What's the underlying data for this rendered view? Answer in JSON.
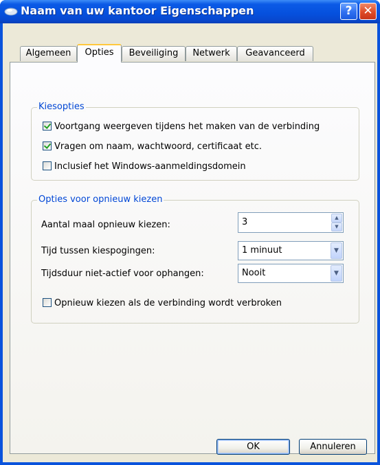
{
  "window": {
    "title": "Naam van uw kantoor Eigenschappen",
    "help_label": "?",
    "close_label": "✕"
  },
  "tabs": [
    {
      "label": "Algemeen"
    },
    {
      "label": "Opties"
    },
    {
      "label": "Beveiliging"
    },
    {
      "label": "Netwerk"
    },
    {
      "label": "Geavanceerd"
    }
  ],
  "active_tab": "Opties",
  "dial_options": {
    "legend": "Kiesopties",
    "checkboxes": [
      {
        "label": "Voortgang weergeven tijdens het maken van de verbinding",
        "checked": true
      },
      {
        "label": "Vragen om naam, wachtwoord, certificaat etc.",
        "checked": true
      },
      {
        "label": "Inclusief het Windows-aanmeldingsdomein",
        "checked": false
      }
    ]
  },
  "redial_options": {
    "legend": "Opties voor opnieuw kiezen",
    "redial_attempts_label": "Aantal maal opnieuw kiezen:",
    "redial_attempts_value": "3",
    "time_between_label": "Tijd tussen kiespogingen:",
    "time_between_value": "1 minuut",
    "idle_time_label": "Tijdsduur niet-actief voor ophangen:",
    "idle_time_value": "Nooit",
    "redial_on_drop_label": "Opnieuw kiezen als de verbinding wordt verbroken",
    "redial_on_drop_checked": false
  },
  "buttons": {
    "ok": "OK",
    "cancel": "Annuleren"
  },
  "colors": {
    "title_bar": "#0550dd",
    "group_legend": "#0046d5",
    "dialog_bg": "#ece9d8",
    "active_tab_accent": "#ffc83c"
  }
}
